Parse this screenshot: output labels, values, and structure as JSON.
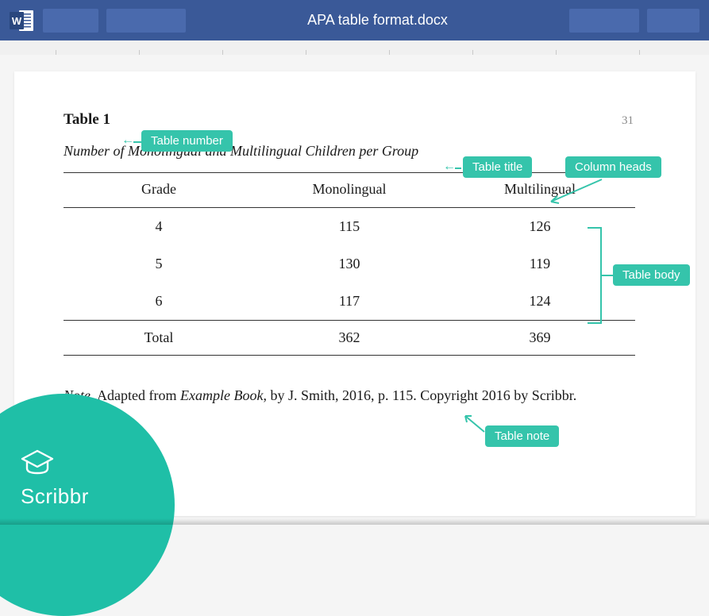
{
  "titlebar": {
    "filename": "APA table format.docx"
  },
  "page": {
    "page_number": "31",
    "table_number": "Table 1",
    "table_title": "Number of Monolingual and Multilingual Children per Group",
    "note_prefix": "Note",
    "note_body": ". Adapted from ",
    "note_book": "Example Book",
    "note_rest": ", by J. Smith, 2016, p. 115. Copyright 2016 by Scribbr."
  },
  "annotations": {
    "table_number": "Table number",
    "table_title": "Table title",
    "column_heads": "Column heads",
    "table_body": "Table body",
    "table_note": "Table note"
  },
  "brand": {
    "name": "Scribbr"
  },
  "chart_data": {
    "type": "table",
    "columns": [
      "Grade",
      "Monolingual",
      "Multilingual"
    ],
    "rows": [
      {
        "grade": "4",
        "monolingual": "115",
        "multilingual": "126"
      },
      {
        "grade": "5",
        "monolingual": "130",
        "multilingual": "119"
      },
      {
        "grade": "6",
        "monolingual": "117",
        "multilingual": "124"
      }
    ],
    "total": {
      "grade": "Total",
      "monolingual": "362",
      "multilingual": "369"
    }
  }
}
